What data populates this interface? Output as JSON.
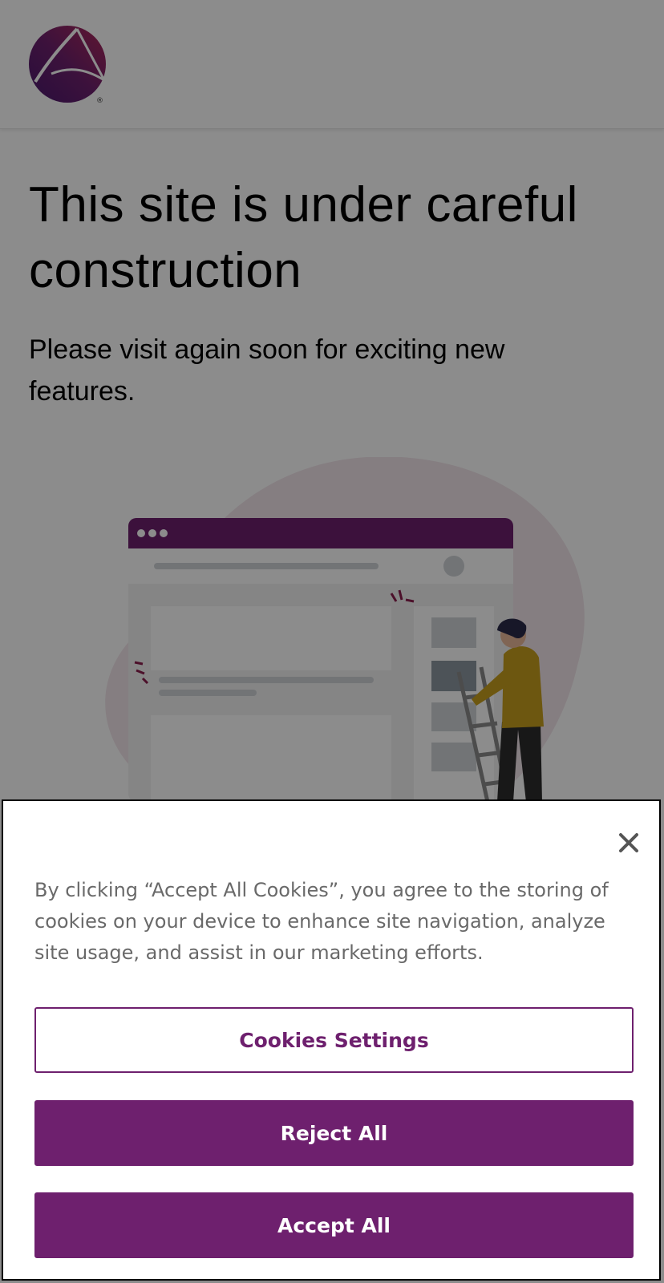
{
  "site": {
    "logo_icon": "cfa-institute-logo-icon",
    "headline": "This site is under careful construction",
    "subtext": "Please visit again soon for exciting new features.",
    "illustration_icon": "under-construction-illustration"
  },
  "cookie_banner": {
    "message": "By clicking “Accept All Cookies”, you agree to the storing of cookies on your device to enhance site navigation, analyze site usage, and assist in our marketing efforts.",
    "close_icon": "close-icon",
    "settings_label": "Cookies Settings",
    "reject_label": "Reject All",
    "accept_label": "Accept All"
  },
  "colors": {
    "brand_purple": "#6e206e",
    "overlay": "rgba(0,0,0,0.45)",
    "banner_text": "#696969"
  }
}
